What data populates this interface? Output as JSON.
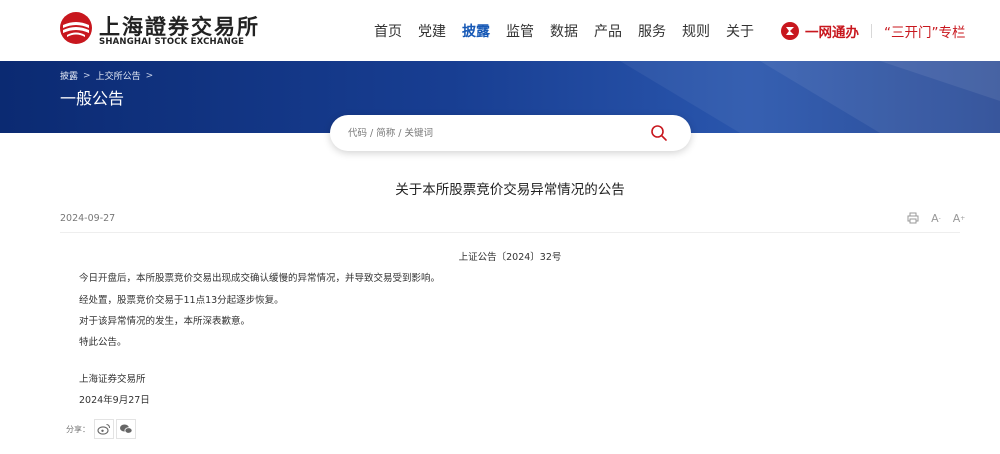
{
  "header": {
    "logo_cn": "上海證券交易所",
    "logo_en": "SHANGHAI STOCK EXCHANGE",
    "nav": [
      "首页",
      "党建",
      "披露",
      "监管",
      "数据",
      "产品",
      "服务",
      "规则",
      "关于"
    ],
    "active_nav": "披露",
    "one_stop": "一网通办",
    "three_open": "“三开门”专栏"
  },
  "breadcrumb": [
    "披露",
    "上交所公告"
  ],
  "page_title": "一般公告",
  "search": {
    "placeholder": "代码 / 简称 / 关键词",
    "value": ""
  },
  "article": {
    "title": "关于本所股票竞价交易异常情况的公告",
    "date": "2024-09-27",
    "doc_no": "上证公告〔2024〕32号",
    "paragraphs": [
      "今日开盘后，本所股票竞价交易出现成交确认缓慢的异常情况，并导致交易受到影响。",
      "经处置，股票竞价交易于11点13分起逐步恢复。",
      "对于该异常情况的发生，本所深表歉意。",
      "特此公告。"
    ],
    "signature_org": "上海证券交易所",
    "signature_date": "2024年9月27日"
  },
  "tools": {
    "print_icon": "print-icon",
    "font_small": "A",
    "font_large": "A"
  },
  "share": {
    "label": "分享：",
    "icons": [
      "weibo-icon",
      "wechat-icon"
    ]
  },
  "colors": {
    "brand_red": "#c8171e",
    "nav_active": "#1759b6",
    "banner": "#183e92"
  }
}
